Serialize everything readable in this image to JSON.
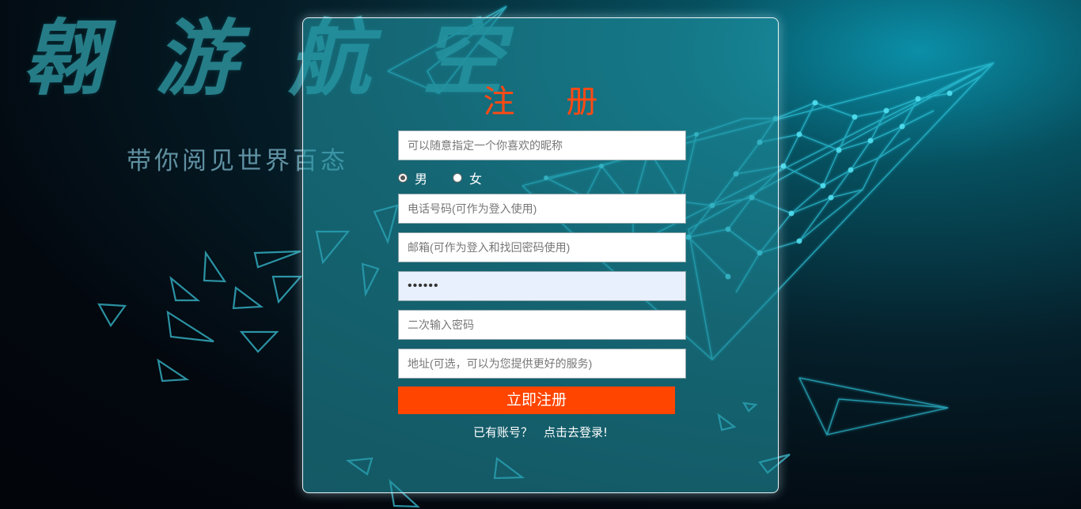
{
  "brand": {
    "title": "翱 游 航 空",
    "slogan": "带你阅见世界百态"
  },
  "form": {
    "title": "注 册",
    "nickname": {
      "placeholder": "可以随意指定一个你喜欢的昵称",
      "value": ""
    },
    "gender": {
      "options": [
        {
          "label": "男",
          "selected": true
        },
        {
          "label": "女",
          "selected": false
        }
      ]
    },
    "phone": {
      "placeholder": "电话号码(可作为登入使用)",
      "value": ""
    },
    "email": {
      "placeholder": "邮箱(可作为登入和找回密码使用)",
      "value": ""
    },
    "password": {
      "value": "••••••"
    },
    "password_confirm": {
      "placeholder": "二次输入密码",
      "value": ""
    },
    "address": {
      "placeholder": "地址(可选，可以为您提供更好的服务)",
      "value": ""
    },
    "submit_label": "立即注册",
    "have_account_text": "已有账号？",
    "login_link_text": "点击去登录!"
  },
  "colors": {
    "accent": "#ff4500",
    "title": "#ff4a14",
    "panel": "#2096a5",
    "background_glow": "#0b8fa8",
    "network": "#35d6ec"
  },
  "icons": {
    "background": "paper-plane-network-illustration"
  }
}
